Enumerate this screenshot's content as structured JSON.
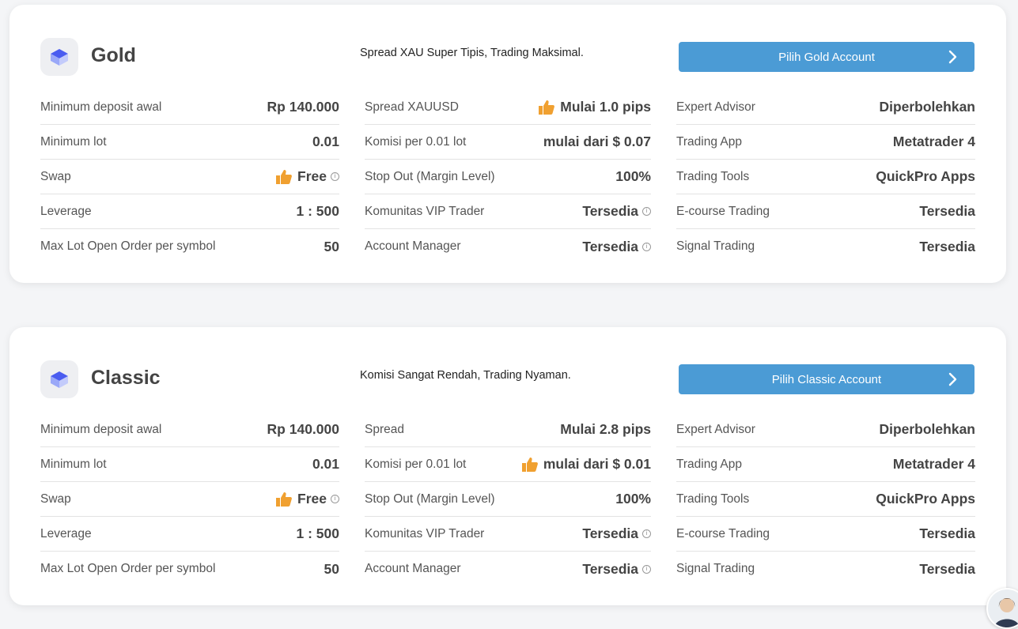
{
  "cards": [
    {
      "title": "Gold",
      "tagline": "Spread XAU Super Tipis, Trading Maksimal.",
      "button_label": "Pilih Gold Account",
      "col1": [
        {
          "label": "Minimum deposit awal",
          "value": "Rp 140.000"
        },
        {
          "label": "Minimum lot",
          "value": "0.01"
        },
        {
          "label": "Swap",
          "value": "Free"
        },
        {
          "label": "Leverage",
          "value": "1 : 500"
        },
        {
          "label": "Max Lot Open Order per symbol",
          "value": "50"
        }
      ],
      "col2": [
        {
          "label": "Spread XAUUSD",
          "value": "Mulai 1.0 pips"
        },
        {
          "label": "Komisi per 0.01 lot",
          "value": "mulai dari $ 0.07"
        },
        {
          "label": "Stop Out (Margin Level)",
          "value": "100%"
        },
        {
          "label": "Komunitas VIP Trader",
          "value": "Tersedia"
        },
        {
          "label": "Account Manager",
          "value": "Tersedia"
        }
      ],
      "col3": [
        {
          "label": "Expert Advisor",
          "value": "Diperbolehkan"
        },
        {
          "label": "Trading App",
          "value": "Metatrader 4"
        },
        {
          "label": "Trading Tools",
          "value": "QuickPro Apps"
        },
        {
          "label": "E-course Trading",
          "value": "Tersedia"
        },
        {
          "label": "Signal Trading",
          "value": "Tersedia"
        }
      ]
    },
    {
      "title": "Classic",
      "tagline": "Komisi Sangat Rendah, Trading Nyaman.",
      "button_label": "Pilih Classic Account",
      "col1": [
        {
          "label": "Minimum deposit awal",
          "value": "Rp 140.000"
        },
        {
          "label": "Minimum lot",
          "value": "0.01"
        },
        {
          "label": "Swap",
          "value": "Free"
        },
        {
          "label": "Leverage",
          "value": "1 : 500"
        },
        {
          "label": "Max Lot Open Order per symbol",
          "value": "50"
        }
      ],
      "col2": [
        {
          "label": "Spread",
          "value": "Mulai 2.8 pips"
        },
        {
          "label": "Komisi per 0.01 lot",
          "value": "mulai dari $ 0.01"
        },
        {
          "label": "Stop Out (Margin Level)",
          "value": "100%"
        },
        {
          "label": "Komunitas VIP Trader",
          "value": "Tersedia"
        },
        {
          "label": "Account Manager",
          "value": "Tersedia"
        }
      ],
      "col3": [
        {
          "label": "Expert Advisor",
          "value": "Diperbolehkan"
        },
        {
          "label": "Trading App",
          "value": "Metatrader 4"
        },
        {
          "label": "Trading Tools",
          "value": "QuickPro Apps"
        },
        {
          "label": "E-course Trading",
          "value": "Tersedia"
        },
        {
          "label": "Signal Trading",
          "value": "Tersedia"
        }
      ]
    }
  ],
  "icons": {
    "logo": "cube-logo-icon",
    "thumb": "thumbs-up-icon",
    "info": "info-icon",
    "chevron": "chevron-right-icon",
    "avatar": "support-avatar"
  },
  "colors": {
    "button": "#4b9bd5",
    "thumb": "#f0a030",
    "logo_top": "#4a5cf0",
    "logo_side": "#9aa8f8"
  },
  "info_glyph": "i"
}
